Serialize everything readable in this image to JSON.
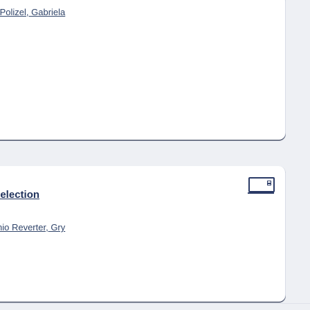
{
  "cards": {
    "top": {
      "authors_text": "̱ Polizel, Gabriela"
    },
    "bottom": {
      "title": "selection",
      "authors_text": "nio Reverter, Gry",
      "expand_icon": "expand-window-icon"
    }
  },
  "colors": {
    "background": "#eef0f4",
    "card": "#ffffff",
    "link": "#31456a",
    "title": "#20325c",
    "accent_border": "#2a3a66"
  }
}
